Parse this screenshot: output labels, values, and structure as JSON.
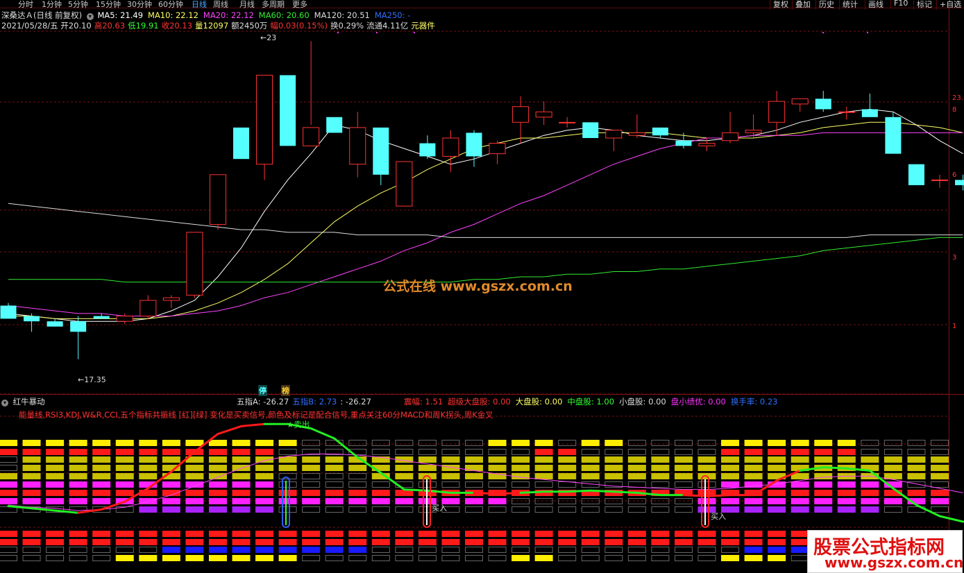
{
  "toolbar": {
    "periods": [
      "分时",
      "1分钟",
      "5分钟",
      "15分钟",
      "30分钟",
      "60分钟",
      "日线",
      "周线",
      "月线",
      "多周期",
      "更多"
    ],
    "active_period": "日线",
    "right_buttons": [
      "复权",
      "叠加",
      "历史",
      "统计",
      "画线",
      "F10",
      "标记",
      "+自选"
    ]
  },
  "main_chart": {
    "title": "深桑达Ａ(日线 前复权)",
    "ma_labels": [
      {
        "text": "MA5: 21.49",
        "color": "#ffffff"
      },
      {
        "text": "MA10: 22.12",
        "color": "#ffff66"
      },
      {
        "text": "MA20: 22.12",
        "color": "#ff44ff"
      },
      {
        "text": "MA60: 20.60",
        "color": "#33ee33"
      },
      {
        "text": "MA120: 20.51",
        "color": "#dddddd"
      },
      {
        "text": "MA250: -",
        "color": "#2f6fff"
      }
    ],
    "quote_line": [
      {
        "text": "2021/05/28/五 开20.10",
        "color": "#dddddd"
      },
      {
        "text": "高20.63",
        "color": "#ff3333"
      },
      {
        "text": "低19.91",
        "color": "#33ff33"
      },
      {
        "text": "收20.13",
        "color": "#ff3333"
      },
      {
        "text": "量12097",
        "color": "#ffff66"
      },
      {
        "text": "额2450万",
        "color": "#dddddd"
      },
      {
        "text": "幅0.03(0.15%)",
        "color": "#ff3333"
      },
      {
        "text": "换0.29%",
        "color": "#dddddd"
      },
      {
        "text": "流通4.11亿",
        "color": "#dddddd"
      },
      {
        "text": "元器件",
        "color": "#ffff66"
      }
    ],
    "price_markers": {
      "high": "23.",
      "high_arrow": "23",
      "low": "17.35"
    },
    "axis_labels": [
      "23.",
      "8",
      "6",
      "3",
      "1"
    ],
    "badges": [
      "停",
      "榜"
    ]
  },
  "chart_data": {
    "type": "candlestick",
    "title": "",
    "ohlc": [
      [
        19.4,
        19.5,
        18.9,
        18.9
      ],
      [
        19.0,
        19.1,
        18.4,
        18.8
      ],
      [
        18.8,
        18.9,
        18.6,
        18.6
      ],
      [
        18.8,
        19.0,
        17.35,
        18.4
      ],
      [
        19.0,
        19.1,
        18.9,
        18.9
      ],
      [
        18.8,
        19.1,
        18.7,
        19.0
      ],
      [
        19.0,
        19.8,
        18.9,
        19.6
      ],
      [
        19.6,
        19.8,
        19.3,
        19.7
      ],
      [
        19.8,
        22.2,
        19.7,
        22.2
      ],
      [
        22.5,
        24.4,
        22.3,
        24.4
      ],
      [
        26.2,
        26.2,
        25.0,
        25.0
      ],
      [
        24.8,
        28.2,
        24.2,
        28.2
      ],
      [
        28.2,
        28.2,
        25.5,
        25.5
      ],
      [
        25.5,
        29.5,
        26.3,
        26.2
      ],
      [
        26.6,
        26.6,
        26.0,
        26.0
      ],
      [
        24.8,
        26.8,
        24.3,
        26.2
      ],
      [
        26.2,
        26.2,
        24.0,
        24.4
      ],
      [
        23.2,
        24.8,
        23.2,
        24.9
      ],
      [
        25.6,
        25.9,
        25.0,
        25.1
      ],
      [
        25.1,
        26.1,
        24.5,
        25.8
      ],
      [
        26.0,
        26.1,
        24.7,
        25.1
      ],
      [
        25.2,
        25.7,
        24.8,
        25.6
      ],
      [
        26.4,
        27.4,
        25.6,
        27.0
      ],
      [
        26.6,
        27.2,
        26.3,
        26.8
      ],
      [
        26.4,
        26.6,
        26.2,
        26.4
      ],
      [
        26.4,
        26.4,
        25.8,
        25.8
      ],
      [
        25.8,
        26.1,
        25.3,
        26.1
      ],
      [
        25.9,
        26.7,
        25.8,
        26.0
      ],
      [
        26.2,
        26.2,
        25.8,
        25.9
      ],
      [
        25.7,
        26.0,
        25.4,
        25.5
      ],
      [
        25.5,
        25.8,
        25.3,
        25.6
      ],
      [
        25.7,
        26.8,
        25.6,
        26.0
      ],
      [
        26.0,
        26.7,
        25.8,
        26.1
      ],
      [
        26.4,
        27.6,
        25.9,
        27.2
      ],
      [
        27.1,
        27.3,
        26.8,
        27.3
      ],
      [
        27.3,
        27.6,
        26.8,
        26.9
      ],
      [
        26.8,
        27.0,
        26.5,
        26.8
      ],
      [
        26.9,
        27.5,
        26.6,
        26.6
      ],
      [
        26.6,
        26.8,
        25.2,
        25.2
      ],
      [
        24.8,
        24.8,
        24.0,
        24.0
      ],
      [
        24.2,
        24.4,
        23.9,
        24.2
      ],
      [
        24.2,
        24.4,
        23.8,
        24.0
      ]
    ],
    "ylim": [
      16.5,
      29.8
    ],
    "series": [
      {
        "name": "MA5",
        "color": "#ffffff",
        "values": [
          19.1,
          19.0,
          18.9,
          18.8,
          18.8,
          18.8,
          18.9,
          19.2,
          19.6,
          20.5,
          21.6,
          23.0,
          24.2,
          25.2,
          26.3,
          26.1,
          25.7,
          25.4,
          25.1,
          24.8,
          25.0,
          25.3,
          25.6,
          25.9,
          26.1,
          26.2,
          26.1,
          25.9,
          25.8,
          25.7,
          25.7,
          25.8,
          25.9,
          26.1,
          26.4,
          26.6,
          26.8,
          26.9,
          26.8,
          26.3,
          25.7,
          25.2
        ]
      },
      {
        "name": "MA10",
        "color": "#ffff66",
        "values": [
          19.0,
          19.0,
          18.9,
          18.9,
          18.9,
          18.9,
          18.9,
          19.0,
          19.2,
          19.5,
          19.9,
          20.4,
          21.0,
          21.8,
          22.6,
          23.2,
          23.7,
          24.1,
          24.6,
          25.0,
          25.4,
          25.6,
          25.8,
          25.8,
          25.9,
          26.0,
          26.0,
          26.0,
          26.0,
          25.9,
          25.8,
          25.8,
          25.8,
          25.9,
          26.0,
          26.2,
          26.3,
          26.4,
          26.4,
          26.3,
          26.2,
          26.0
        ]
      },
      {
        "name": "MA20",
        "color": "#ff44ff",
        "values": [
          19.4,
          19.3,
          19.2,
          19.1,
          19.1,
          19.0,
          19.0,
          19.0,
          19.1,
          19.2,
          19.4,
          19.7,
          19.9,
          20.2,
          20.5,
          20.8,
          21.1,
          21.5,
          21.8,
          22.2,
          22.5,
          22.9,
          23.3,
          23.6,
          24.0,
          24.4,
          24.8,
          25.1,
          25.4,
          25.6,
          25.8,
          25.8,
          25.9,
          25.9,
          25.9,
          26.0,
          26.0,
          26.0,
          26.0,
          26.0,
          26.0,
          26.0
        ]
      },
      {
        "name": "MA60",
        "color": "#33ee33",
        "values": [
          20.4,
          20.4,
          20.4,
          20.4,
          20.4,
          20.3,
          20.3,
          20.3,
          20.3,
          20.3,
          20.3,
          20.3,
          20.3,
          20.3,
          20.3,
          20.3,
          20.3,
          20.3,
          20.3,
          20.3,
          20.4,
          20.4,
          20.5,
          20.5,
          20.6,
          20.6,
          20.7,
          20.7,
          20.8,
          20.8,
          20.9,
          21.0,
          21.1,
          21.2,
          21.3,
          21.5,
          21.6,
          21.7,
          21.8,
          21.9,
          22.0,
          22.0
        ]
      },
      {
        "name": "MA120",
        "color": "#dddddd",
        "values": [
          23.3,
          23.2,
          23.1,
          23.0,
          22.9,
          22.8,
          22.7,
          22.6,
          22.5,
          22.4,
          22.3,
          22.3,
          22.2,
          22.2,
          22.2,
          22.1,
          22.1,
          22.1,
          22.1,
          22.0,
          22.0,
          22.0,
          22.0,
          22.0,
          22.0,
          22.0,
          22.0,
          22.0,
          22.0,
          22.0,
          22.0,
          22.0,
          22.0,
          22.0,
          22.0,
          22.0,
          22.0,
          22.1,
          22.1,
          22.1,
          22.1,
          22.1
        ]
      }
    ]
  },
  "indicator": {
    "title": "红牛暴动",
    "values_line": [
      {
        "text": "五指A: -26.27",
        "color": "#dddddd"
      },
      {
        "text": "五指B: 2.73",
        "color": "#2f6fff"
      },
      {
        "text": ": -26.27",
        "color": "#dddddd"
      }
    ],
    "stats_line": [
      {
        "text": "震幅: 1.51",
        "color": "#ff3333"
      },
      {
        "text": "超级大盘股: 0.00",
        "color": "#ff3333"
      },
      {
        "text": "大盘股: 0.00",
        "color": "#ffff66"
      },
      {
        "text": "中盘股: 1.00",
        "color": "#33ff33"
      },
      {
        "text": "小盘股: 0.00",
        "color": "#dddddd"
      },
      {
        "text": "盘小绩优: 0.00",
        "color": "#ff33ff"
      },
      {
        "text": "换手率: 0.23",
        "color": "#2f6fff"
      }
    ],
    "description": "能量线,RSI3,KDJ,W&R,CCI,五个指标共振线 [红][绿] 变化是买卖信号,颜色及标记是配合信号,重点关注60分MACD和周K拐头,周K金叉",
    "sell_label": "★卖出",
    "buy_labels": [
      "买入",
      "买入"
    ],
    "main_line": [
      88,
      84,
      80,
      76,
      82,
      96,
      120,
      150,
      186,
      218,
      232,
      236,
      236,
      228,
      210,
      176,
      148,
      118,
      116,
      112,
      112,
      110,
      112,
      114,
      114,
      116,
      114,
      112,
      108,
      108,
      106,
      108,
      108,
      134,
      152,
      158,
      156,
      152,
      120,
      90,
      70,
      60
    ],
    "main_line_red": [
      false,
      false,
      false,
      false,
      true,
      true,
      true,
      true,
      true,
      true,
      true,
      true,
      false,
      false,
      false,
      false,
      false,
      false,
      false,
      false,
      false,
      true,
      true,
      false,
      false,
      false,
      false,
      false,
      false,
      false,
      true,
      true,
      true,
      true,
      true,
      false,
      false,
      false,
      false,
      false,
      false,
      false
    ],
    "thin_line": [
      90,
      86,
      84,
      80,
      82,
      86,
      96,
      108,
      124,
      140,
      156,
      170,
      178,
      182,
      182,
      180,
      176,
      170,
      164,
      158,
      152,
      146,
      140,
      136,
      132,
      128,
      124,
      122,
      120,
      118,
      118,
      120,
      124,
      128,
      134,
      140,
      142,
      142,
      136,
      128,
      120,
      112
    ],
    "ylim": [
      0,
      250
    ]
  },
  "watermarks": {
    "center": "公式在线  www.gszx.com.cn",
    "corner_title": "股票公式指标网",
    "corner_url": "www.gszx.com.cn"
  },
  "colors": {
    "up": "#ff3333",
    "down": "#55ffff",
    "grid": "#7a1010",
    "yellow": "#ffee00",
    "red": "#ff1a1a",
    "olive": "#c8c000",
    "magenta": "#ff22ff",
    "purple": "#aa22ff",
    "blue": "#1a1aff"
  }
}
